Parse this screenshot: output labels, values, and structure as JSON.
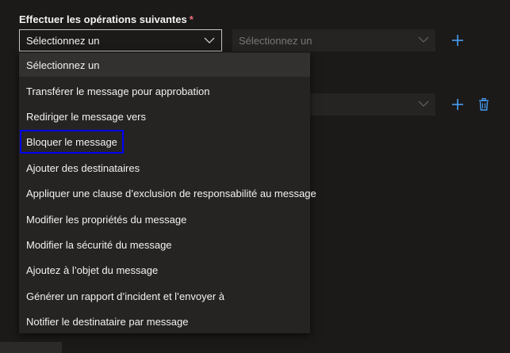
{
  "section": {
    "label": "Effectuer les opérations suivantes",
    "required_mark": "*"
  },
  "primary_select": {
    "value": "Sélectionnez un"
  },
  "secondary_select": {
    "placeholder": "Sélectionnez un"
  },
  "dropdown": {
    "options": [
      "Sélectionnez un",
      "Transférer le message pour approbation",
      "Rediriger le message vers",
      "Bloquer le message",
      "Ajouter des destinataires",
      "Appliquer une clause d’exclusion de responsabilité au message",
      "Modifier les propriétés du message",
      "Modifier la sécurité du message",
      "Ajoutez à l’objet du message",
      "Générer un rapport d’incident et l’envoyer à",
      "Notifier le destinataire par message"
    ],
    "selected_index": 0,
    "highlighted_index": 3
  },
  "colors": {
    "background": "#1b1a19",
    "accent": "#0078d4",
    "highlight": "#0000ff",
    "required": "#f1707b"
  },
  "icons": {
    "add": "add-icon",
    "delete": "trash-icon",
    "chevron": "chevron-down-icon"
  }
}
